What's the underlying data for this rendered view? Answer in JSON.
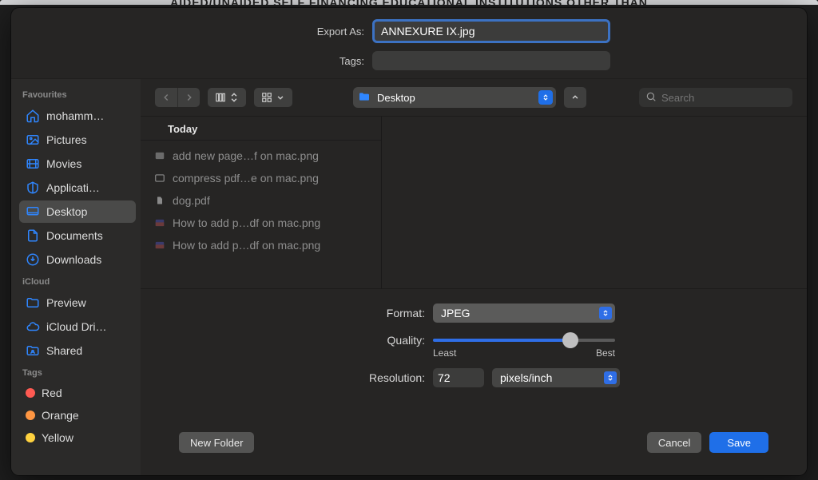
{
  "background_banner": "AIDED/UNAIDED SELF FINANCING EDUCATIONAL INSTITUTIONS OTHER THAN",
  "export": {
    "label": "Export As:",
    "filename": "ANNEXURE IX.jpg",
    "tags_label": "Tags:"
  },
  "sidebar": {
    "headings": {
      "favourites": "Favourites",
      "icloud": "iCloud",
      "tags": "Tags"
    },
    "favourites": [
      {
        "label": "mohamm…",
        "icon": "home"
      },
      {
        "label": "Pictures",
        "icon": "pictures"
      },
      {
        "label": "Movies",
        "icon": "movies"
      },
      {
        "label": "Applicati…",
        "icon": "apps"
      },
      {
        "label": "Desktop",
        "icon": "desktop",
        "selected": true
      },
      {
        "label": "Documents",
        "icon": "doc"
      },
      {
        "label": "Downloads",
        "icon": "downloads"
      }
    ],
    "icloud": [
      {
        "label": "Preview",
        "icon": "folder"
      },
      {
        "label": "iCloud Dri…",
        "icon": "cloud"
      },
      {
        "label": "Shared",
        "icon": "shared"
      }
    ],
    "tags": [
      {
        "label": "Red",
        "color": "#ff5a52"
      },
      {
        "label": "Orange",
        "color": "#ff9642"
      },
      {
        "label": "Yellow",
        "color": "#ffd23f"
      }
    ]
  },
  "toolbar": {
    "location": "Desktop",
    "search_placeholder": "Search"
  },
  "files": {
    "group_header": "Today",
    "items": [
      {
        "name": "add new page…f on mac.png",
        "kind": "image"
      },
      {
        "name": "compress pdf…e on mac.png",
        "kind": "image2"
      },
      {
        "name": "dog.pdf",
        "kind": "pdf"
      },
      {
        "name": "How to add p…df on mac.png",
        "kind": "image3"
      },
      {
        "name": "How to add p…df on mac.png",
        "kind": "image3"
      }
    ]
  },
  "options": {
    "format_label": "Format:",
    "format_value": "JPEG",
    "quality_label": "Quality:",
    "quality_value": 78,
    "quality_least": "Least",
    "quality_best": "Best",
    "resolution_label": "Resolution:",
    "resolution_value": "72",
    "resolution_units": "pixels/inch"
  },
  "footer": {
    "new_folder": "New Folder",
    "cancel": "Cancel",
    "save": "Save"
  },
  "annotations": {
    "arrow_color": "#f04a2b"
  }
}
